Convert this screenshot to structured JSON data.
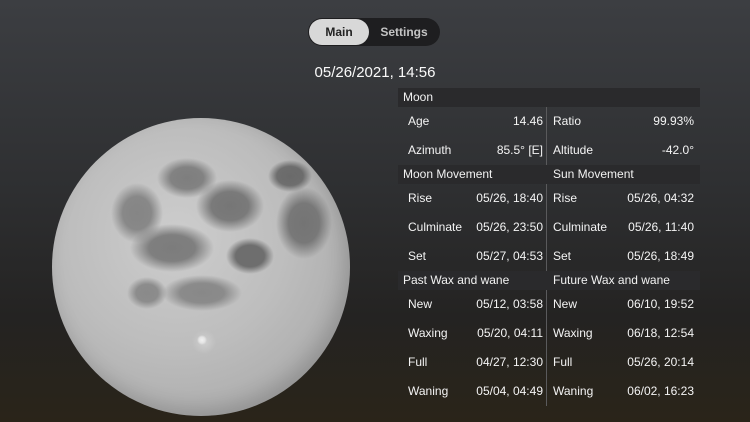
{
  "segmented": {
    "main": "Main",
    "settings": "Settings"
  },
  "datetime": "05/26/2021, 14:56",
  "moon_image": {
    "subject": "full-moon"
  },
  "sections": {
    "moon": {
      "title": "Moon",
      "rows": [
        {
          "l_label": "Age",
          "l_value": "14.46",
          "r_label": "Ratio",
          "r_value": "99.93%"
        },
        {
          "l_label": "Azimuth",
          "l_value": "85.5° [E]",
          "r_label": "Altitude",
          "r_value": "-42.0°"
        }
      ]
    },
    "movement": {
      "title_left": "Moon Movement",
      "title_right": "Sun Movement",
      "rows": [
        {
          "l_label": "Rise",
          "l_value": "05/26, 18:40",
          "r_label": "Rise",
          "r_value": "05/26, 04:32"
        },
        {
          "l_label": "Culminate",
          "l_value": "05/26, 23:50",
          "r_label": "Culminate",
          "r_value": "05/26, 11:40"
        },
        {
          "l_label": "Set",
          "l_value": "05/27, 04:53",
          "r_label": "Set",
          "r_value": "05/26, 18:49"
        }
      ]
    },
    "wax": {
      "title_left": "Past Wax and wane",
      "title_right": "Future Wax and wane",
      "rows": [
        {
          "l_label": "New",
          "l_value": "05/12, 03:58",
          "r_label": "New",
          "r_value": "06/10, 19:52"
        },
        {
          "l_label": "Waxing",
          "l_value": "05/20, 04:11",
          "r_label": "Waxing",
          "r_value": "06/18, 12:54"
        },
        {
          "l_label": "Full",
          "l_value": "04/27, 12:30",
          "r_label": "Full",
          "r_value": "05/26, 20:14"
        },
        {
          "l_label": "Waning",
          "l_value": "05/04, 04:49",
          "r_label": "Waning",
          "r_value": "06/02, 16:23"
        }
      ]
    }
  }
}
